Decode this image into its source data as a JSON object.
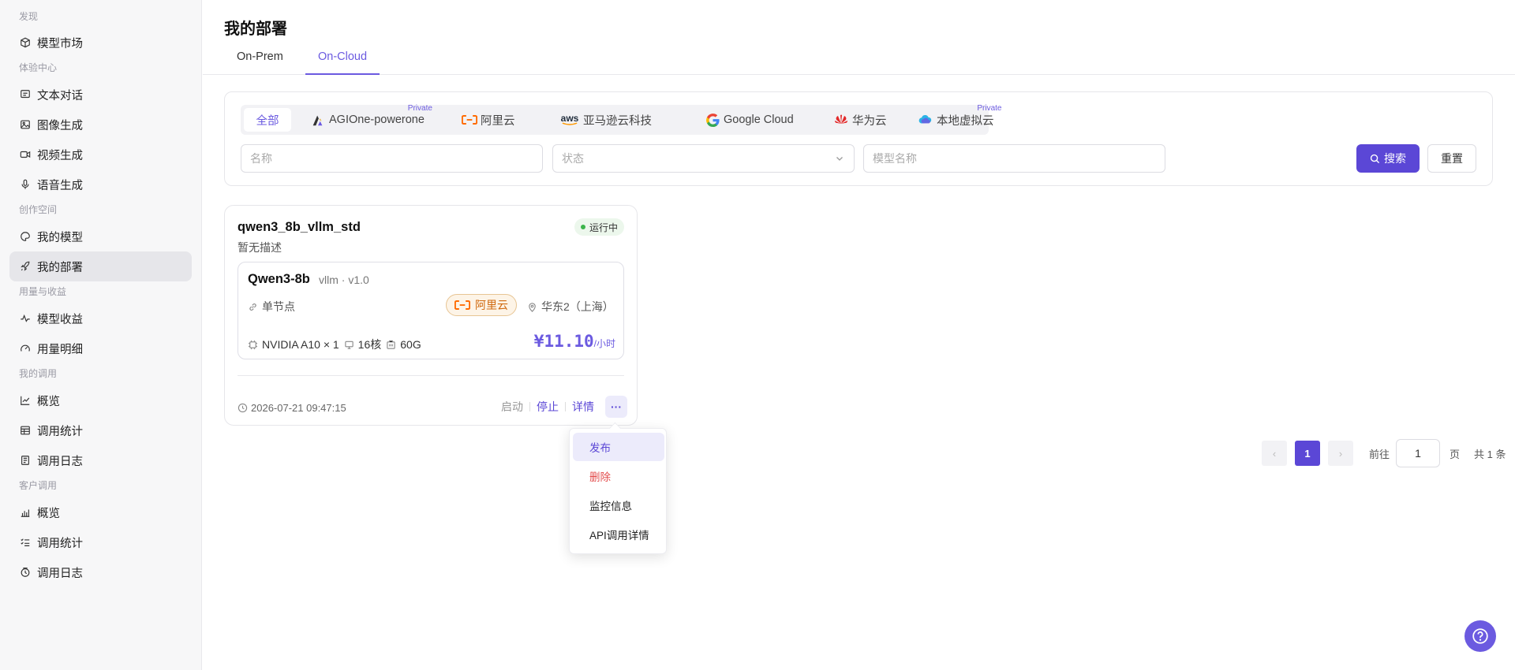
{
  "sidebar": {
    "groups": [
      "发现",
      "体验中心",
      "创作空间",
      "用量与收益",
      "我的调用",
      "客户调用"
    ],
    "items": [
      {
        "label": "模型市场"
      },
      {
        "label": "文本对话"
      },
      {
        "label": "图像生成"
      },
      {
        "label": "视频生成"
      },
      {
        "label": "语音生成"
      },
      {
        "label": "我的模型"
      },
      {
        "label": "我的部署"
      },
      {
        "label": "模型收益"
      },
      {
        "label": "用量明细"
      },
      {
        "label": "概览"
      },
      {
        "label": "调用统计"
      },
      {
        "label": "调用日志"
      },
      {
        "label": "概览"
      },
      {
        "label": "调用统计"
      },
      {
        "label": "调用日志"
      }
    ]
  },
  "page": {
    "title": "我的部署"
  },
  "tabs": [
    {
      "label": "On-Prem"
    },
    {
      "label": "On-Cloud"
    }
  ],
  "providers": [
    {
      "label": "全部"
    },
    {
      "label": "AGIOne-powerone",
      "tag": "Private"
    },
    {
      "label": "阿里云"
    },
    {
      "label": "亚马逊云科技",
      "logo_text": "aws"
    },
    {
      "label": "Google Cloud"
    },
    {
      "label": "华为云"
    },
    {
      "label": "本地虚拟云",
      "tag": "Private"
    }
  ],
  "filters": {
    "name_placeholder": "名称",
    "status_placeholder": "状态",
    "model_placeholder": "模型名称",
    "search_label": "搜索",
    "reset_label": "重置"
  },
  "card": {
    "name": "qwen3_8b_vllm_std",
    "description": "暂无描述",
    "status": "运行中",
    "model": "Qwen3-8b",
    "engine": "vllm · v1.0",
    "node_type": "单节点",
    "provider": "阿里云",
    "region": "华东2（上海）",
    "gpu": "NVIDIA A10 × 1",
    "cpu": "16核",
    "memory": "60G",
    "price": "¥11.10",
    "price_unit": "/小时",
    "created_at": "2026-07-21 09:47:15",
    "actions": {
      "start": "启动",
      "stop": "停止",
      "detail": "详情",
      "more": "···"
    }
  },
  "menu": [
    "发布",
    "删除",
    "监控信息",
    "API调用详情"
  ],
  "pagination": {
    "prev": "‹",
    "current": "1",
    "next": "›",
    "goto_label": "前往",
    "goto_value": "1",
    "page_unit": "页",
    "total": "共 1 条"
  },
  "colors": {
    "accent": "#5b47d6",
    "danger": "#e34d4d",
    "running": "#3bb44a",
    "aliyun": "#ff6a00"
  }
}
